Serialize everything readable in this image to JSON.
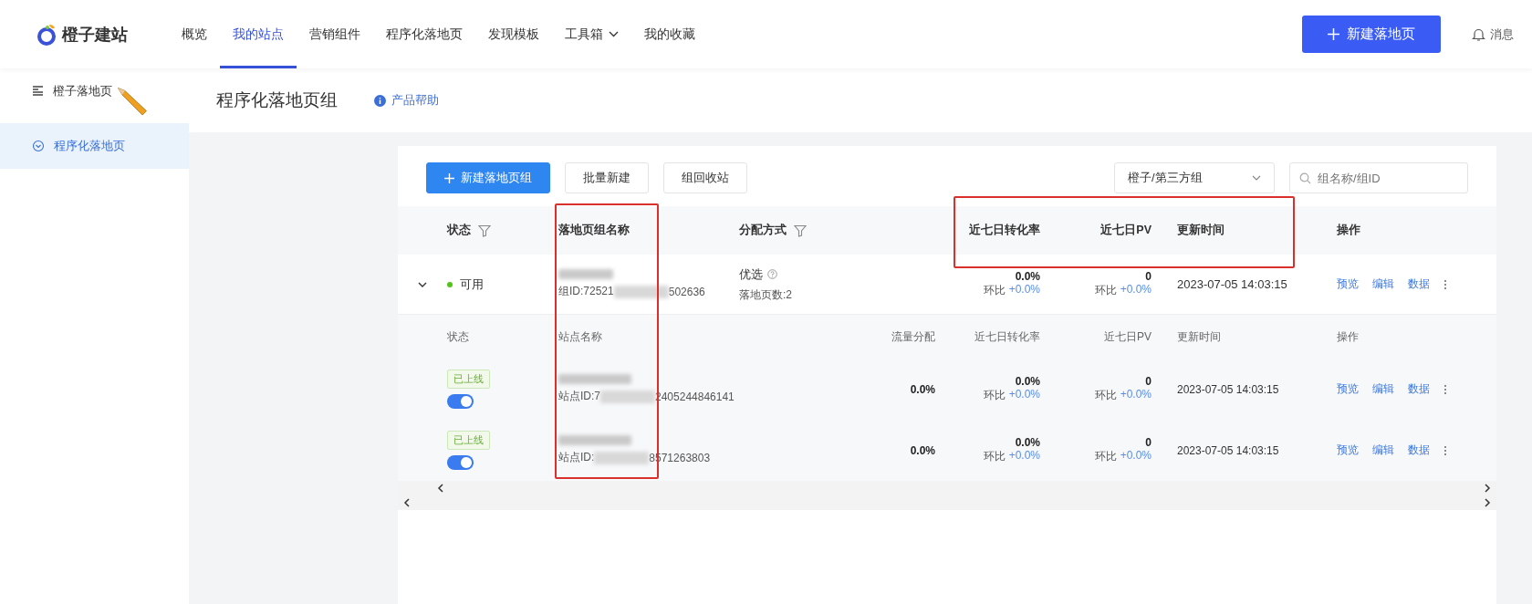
{
  "header": {
    "logo": "橙子建站",
    "nav": [
      {
        "label": "概览",
        "selected": false
      },
      {
        "label": "我的站点",
        "selected": true
      },
      {
        "label": "营销组件",
        "selected": false
      },
      {
        "label": "程序化落地页",
        "selected": false
      },
      {
        "label": "发现模板",
        "selected": false
      },
      {
        "label": "工具箱",
        "selected": false,
        "dropdown": true
      },
      {
        "label": "我的收藏",
        "selected": false
      }
    ],
    "create_button": "新建落地页",
    "messages": "消息"
  },
  "sidebar": {
    "items": [
      {
        "label": "橙子落地页",
        "selected": false
      },
      {
        "label": "程序化落地页",
        "selected": true
      }
    ]
  },
  "page": {
    "title": "程序化落地页组",
    "help": "产品帮助"
  },
  "toolbar": {
    "buttons": [
      {
        "label": "新建落地页组",
        "kind": "primary"
      },
      {
        "label": "批量新建",
        "kind": "default"
      },
      {
        "label": "组回收站",
        "kind": "default"
      }
    ],
    "group_select": "橙子/第三方组",
    "search_placeholder": "组名称/组ID"
  },
  "table": {
    "columns": [
      {
        "label": "状态",
        "filter": true
      },
      {
        "label": "落地页组名称",
        "filter": false
      },
      {
        "label": "分配方式",
        "filter": true
      },
      {
        "label": "近七日转化率",
        "filter": false
      },
      {
        "label": "近七日PV",
        "filter": false
      },
      {
        "label": "更新时间",
        "filter": false
      },
      {
        "label": "操作",
        "filter": false
      }
    ],
    "group": {
      "expanded": true,
      "status": "可用",
      "id_start": "组ID:72521",
      "id_end": "502636",
      "allocation": "优选",
      "page_count": "落地页数:2",
      "conversion": "0.0%",
      "conversion_change_label": "环比",
      "conversion_change": "+0.0%",
      "pv": "0",
      "pv_change_label": "环比",
      "pv_change": "+0.0%",
      "updated": "2023-07-05 14:03:15",
      "actions": [
        "预览",
        "编辑",
        "数据"
      ]
    },
    "sub_columns": [
      "状态",
      "站点名称",
      "流量分配",
      "近七日转化率",
      "近七日PV",
      "更新时间",
      "操作"
    ],
    "sites": [
      {
        "status": "已上线",
        "on": true,
        "id_start": "站点ID:7",
        "id_end": "2405244846141",
        "traffic": "0.0%",
        "conversion": "0.0%",
        "conversion_change_label": "环比",
        "conversion_change": "+0.0%",
        "pv": "0",
        "pv_change_label": "环比",
        "pv_change": "+0.0%",
        "updated": "2023-07-05 14:03:15",
        "actions": [
          "预览",
          "编辑",
          "数据"
        ]
      },
      {
        "status": "已上线",
        "on": true,
        "id_start": "站点ID:",
        "id_end": "8571263803",
        "traffic": "0.0%",
        "conversion": "0.0%",
        "conversion_change_label": "环比",
        "conversion_change": "+0.0%",
        "pv": "0",
        "pv_change_label": "环比",
        "pv_change": "+0.0%",
        "updated": "2023-07-05 14:03:15",
        "actions": [
          "预览",
          "编辑",
          "数据"
        ]
      }
    ]
  },
  "highlights": {
    "name_column": true,
    "metric_headers": true
  }
}
